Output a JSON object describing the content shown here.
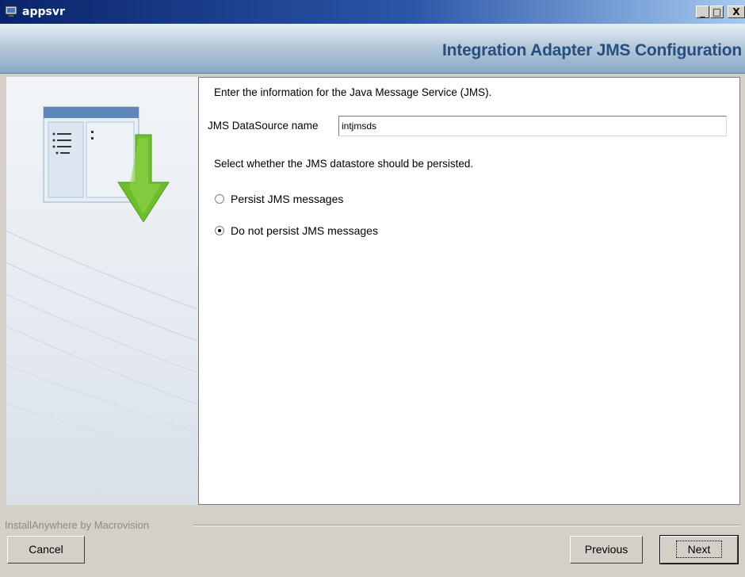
{
  "window": {
    "title": "appsvr",
    "controls": {
      "minimize": "_",
      "maximize": "□",
      "close": "X"
    }
  },
  "header": {
    "title": "Integration Adapter JMS Configuration"
  },
  "content": {
    "intro": "Enter the information for the Java Message Service (JMS).",
    "datasource_label": "JMS DataSource name",
    "datasource_value": "intjmsds",
    "select_prompt": "Select whether the JMS datastore should be persisted.",
    "options": [
      {
        "label": "Persist JMS messages",
        "checked": false
      },
      {
        "label": "Do not persist JMS messages",
        "checked": true
      }
    ]
  },
  "footer": {
    "brand": "InstallAnywhere by Macrovision",
    "cancel_label": "Cancel",
    "previous_label": "Previous",
    "next_label": "Next"
  },
  "colors": {
    "titlebar_start": "#0a246a",
    "header_title": "#264f80",
    "arrow_green": "#6cbf2a"
  }
}
